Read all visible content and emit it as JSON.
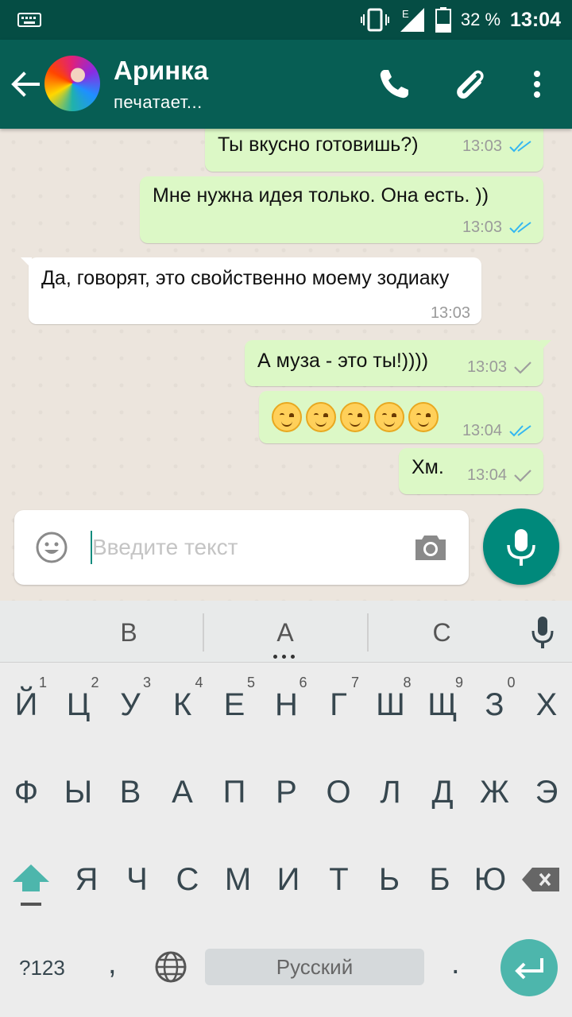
{
  "status_bar": {
    "network": "E",
    "battery": "32 %",
    "time": "13:04",
    "icons": [
      "keyboard-icon",
      "vibrate-icon",
      "signal-icon",
      "battery-icon"
    ]
  },
  "header": {
    "contact_name": "Аринка",
    "status": "печатает...",
    "icons": [
      "back-arrow-icon",
      "phone-icon",
      "paperclip-icon",
      "more-vert-icon"
    ],
    "bg_color": "#075e54"
  },
  "messages": [
    {
      "dir": "out",
      "text": "Ты вкусно готовишь?)",
      "time": "13:03",
      "ticks": "read"
    },
    {
      "dir": "out",
      "text": "Мне нужна идея только. Она есть. ))",
      "time": "13:03",
      "ticks": "read"
    },
    {
      "dir": "in",
      "text": "Да, говорят, это свойственно моему зодиаку",
      "time": "13:03"
    },
    {
      "dir": "out",
      "text": "А муза - это ты!))))",
      "time": "13:03",
      "ticks": "sent"
    },
    {
      "dir": "out",
      "text": "☺☺☺☺☺",
      "time": "13:04",
      "ticks": "read"
    },
    {
      "dir": "out",
      "text": "Хм.",
      "time": "13:04",
      "ticks": "sent"
    }
  ],
  "input": {
    "placeholder": "Введите текст",
    "value": ""
  },
  "keyboard": {
    "suggestions": [
      "В",
      "А",
      "С"
    ],
    "row1": [
      "Й",
      "Ц",
      "У",
      "К",
      "Е",
      "Н",
      "Г",
      "Ш",
      "Щ",
      "З",
      "Х"
    ],
    "row1_nums": [
      "1",
      "2",
      "3",
      "4",
      "5",
      "6",
      "7",
      "8",
      "9",
      "0",
      ""
    ],
    "row2": [
      "Ф",
      "Ы",
      "В",
      "А",
      "П",
      "Р",
      "О",
      "Л",
      "Д",
      "Ж",
      "Э"
    ],
    "row3": [
      "Я",
      "Ч",
      "С",
      "М",
      "И",
      "Т",
      "Ь",
      "Б",
      "Ю"
    ],
    "symbols_key": "?123",
    "comma": ",",
    "space_label": "Русский",
    "period": "."
  },
  "colors": {
    "out_bubble": "#dcf8c6",
    "in_bubble": "#ffffff",
    "read_tick": "#34b7f1",
    "sent_tick": "#9e9e9e",
    "accent": "#00897b"
  }
}
